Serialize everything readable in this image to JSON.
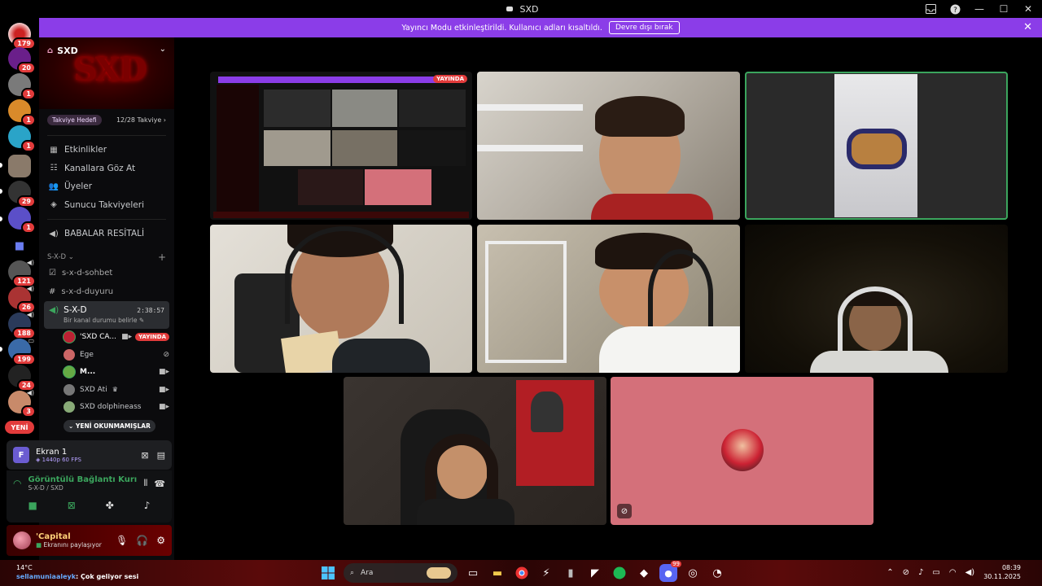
{
  "window": {
    "title": "SXD"
  },
  "banner": {
    "text": "Yayıncı Modu etkinleştirildi. Kullanıcı adları kısaltıldı.",
    "button": "Devre dışı bırak"
  },
  "rail": {
    "badges": [
      "179",
      "20",
      "1",
      "1",
      "1",
      "1",
      "29",
      "1",
      "121",
      "26",
      "188",
      "199",
      "24",
      "3"
    ],
    "new_label": "YENİ"
  },
  "server": {
    "name": "SXD",
    "logo_text": "SXD",
    "boost_goal": "Takviye Hedefi",
    "boost_count": "12/28 Takviye",
    "menu": [
      "Etkinlikler",
      "Kanallara Göz At",
      "Üyeler",
      "Sunucu Takviyeleri"
    ],
    "stage_channel": "BABALAR RESİTALİ",
    "category": "S-X-D",
    "text_channels": [
      "s-x-d-sohbet",
      "s-x-d-duyuru"
    ],
    "voice_channel": {
      "name": "S-X-D",
      "timer": "2:38:57",
      "status": "Bir kanal durumu belirle"
    },
    "voice_users": [
      {
        "name": "'SXD CA...",
        "badge": "YAYINDA"
      },
      {
        "name": "Ege"
      },
      {
        "name": "M..."
      },
      {
        "name": "SXD Ati"
      },
      {
        "name": "SXD dolphineass"
      }
    ],
    "unread": "YENİ OKUNMAMIŞLAR"
  },
  "screen_share": {
    "letter": "F",
    "title": "Ekran 1",
    "quality": "1440p 60 FPS"
  },
  "voice_status": {
    "title": "Görüntülü Bağlantı Kurı",
    "path": "S-X-D / SXD"
  },
  "user": {
    "name": "'Capital",
    "status": "Ekranını paylaşıyor"
  },
  "stream": {
    "live_badge": "YAYINDA"
  },
  "taskbar": {
    "weather_temp": "14°C",
    "weather_user": "sellamuniaaleyk",
    "now_playing": ": Çok geliyor sesi",
    "search_placeholder": "Ara",
    "time": "08:39",
    "date": "30.11.2025",
    "notif_badge": "99"
  },
  "colors": {
    "accent": "#8b3de8",
    "speaking": "#3ba55d",
    "live": "#e23b3b",
    "pink_tile": "#d4707a"
  }
}
